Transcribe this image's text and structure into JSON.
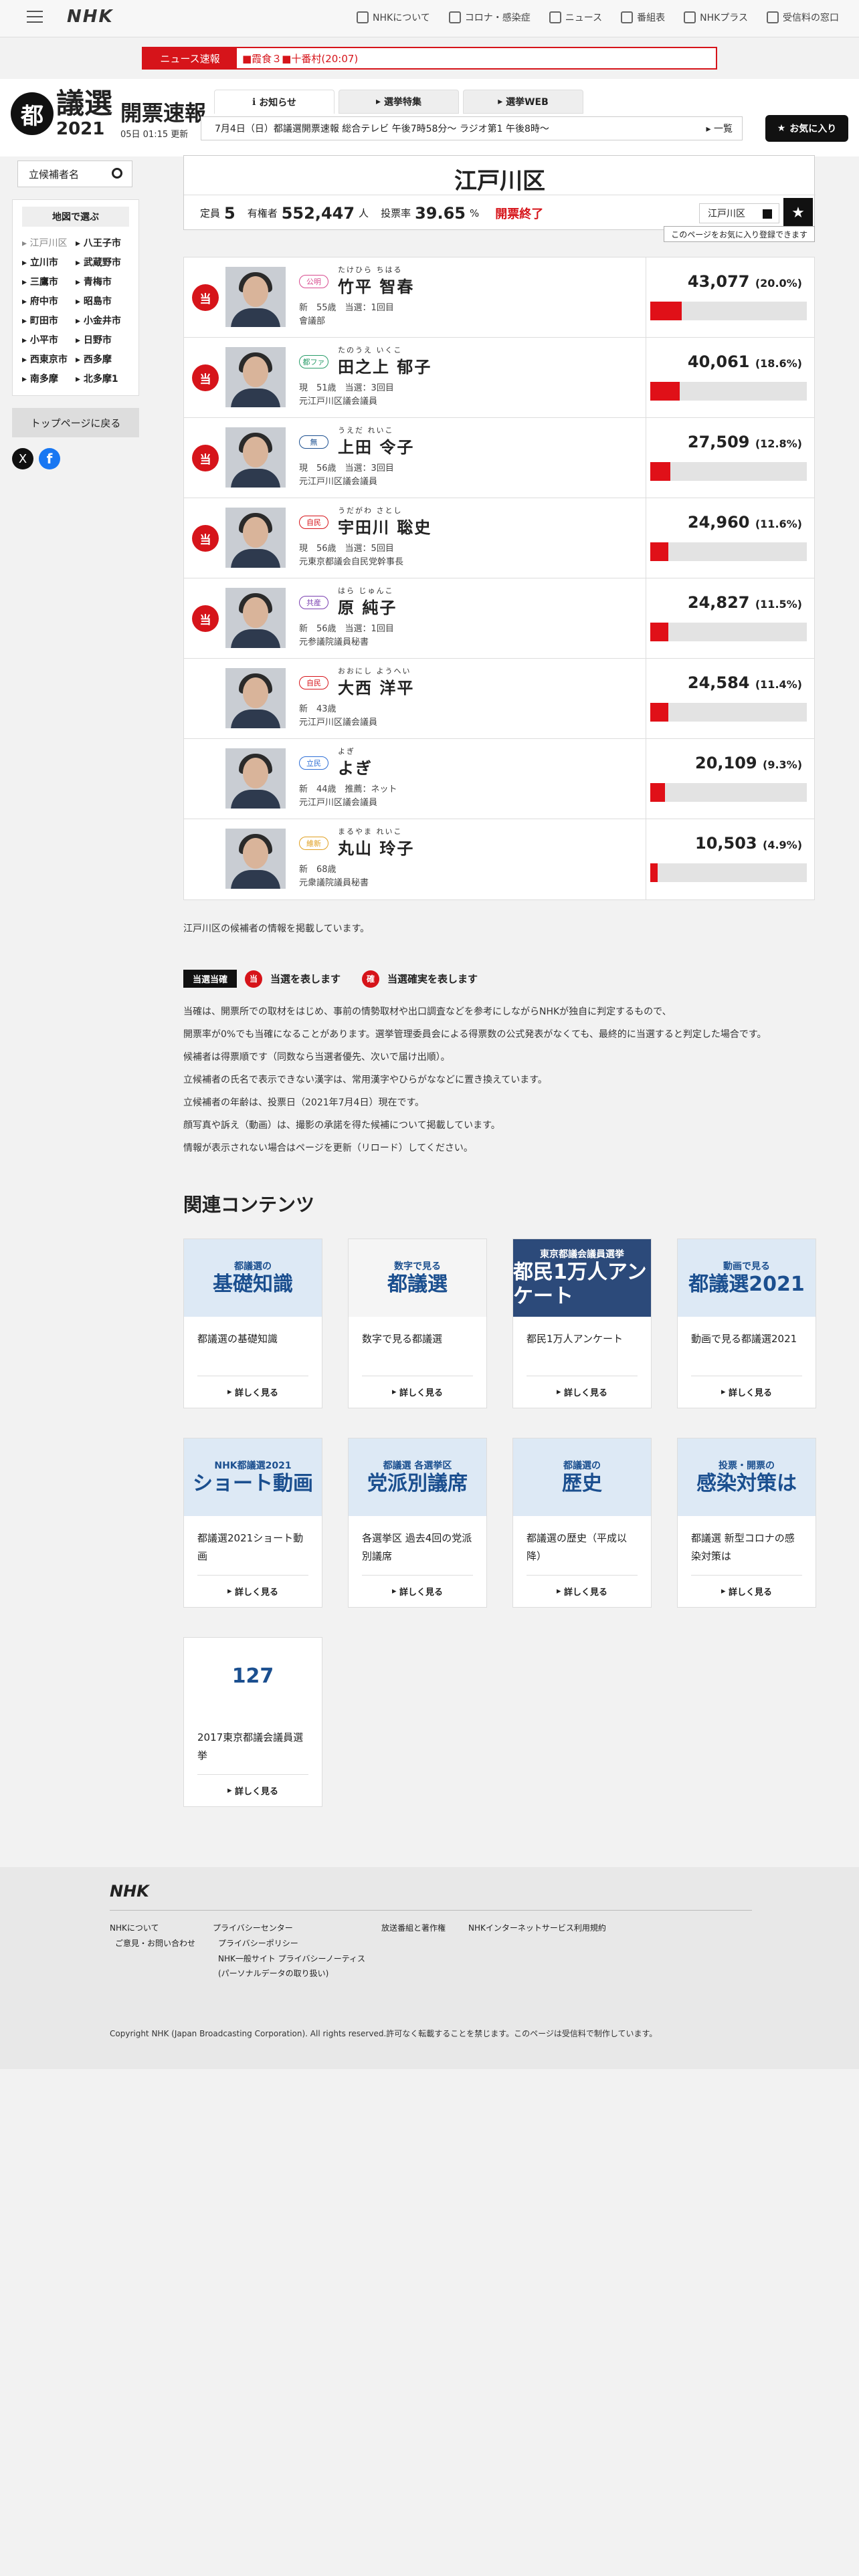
{
  "nav": {
    "logo": "NHK",
    "menu": [
      "NHKについて",
      "コロナ・感染症",
      "ニュース",
      "番組表",
      "NHKプラス",
      "受信料の窓口"
    ]
  },
  "breaking": {
    "label": "ニュース速報",
    "text": "■霞食３■十番村(20:07)"
  },
  "header": {
    "emblem": "都",
    "giin": "議選",
    "year": "2021",
    "title": "開票速報",
    "updated": "05日 01:15 更新",
    "tabs": [
      "お知らせ",
      "選挙特集",
      "選挙WEB"
    ],
    "ticker": "7月4日（日）都議選開票速報 総合テレビ 午後7時58分～ ラジオ第1 午後8時～",
    "ticker_more": "一覧",
    "fav_button": "お気に入り"
  },
  "sidebar": {
    "search_label": "立候補者名",
    "map_label": "地図で選ぶ",
    "districts": [
      "江戸川区",
      "八王子市",
      "立川市",
      "武蔵野市",
      "三鷹市",
      "青梅市",
      "府中市",
      "昭島市",
      "町田市",
      "小金井市",
      "小平市",
      "日野市",
      "西東京市",
      "西多摩",
      "南多摩",
      "北多摩1"
    ],
    "back_button": "トップページに戻る",
    "x_label": "X",
    "fb_label": "f"
  },
  "district": {
    "name": "江戸川区",
    "seats_label": "定員",
    "seats": "5",
    "voters_label": "有権者",
    "voters": "552,447",
    "voters_unit": "人",
    "turnout_label": "投票率",
    "turnout": "39.65",
    "turnout_unit": "%",
    "status": "開票終了",
    "select_value": "江戸川区",
    "register_note": "このページをお気に入り登録できます"
  },
  "candidates": [
    {
      "won": "当",
      "party": "公明",
      "party_color": "#d84b8f",
      "kana": "たけひら ちはる",
      "name": "竹平 智春",
      "meta": "新　55歳　当選：1回目",
      "career": "會議部",
      "votes": "43,077",
      "pct": "(20.0%)",
      "share": 0.2
    },
    {
      "won": "当",
      "party": "都ファ",
      "party_color": "#2a9d6a",
      "kana": "たのうえ いくこ",
      "name": "田之上 郁子",
      "meta": "現　51歳　当選：3回目",
      "career": "元江戸川区議会議員",
      "votes": "40,061",
      "pct": "(18.6%)",
      "share": 0.186
    },
    {
      "won": "当",
      "party": "無",
      "party_color": "#1b4f8f",
      "kana": "うえだ れいこ",
      "name": "上田 令子",
      "meta": "現　56歳　当選：3回目",
      "career": "元江戸川区議会議員",
      "votes": "27,509",
      "pct": "(12.8%)",
      "share": 0.128
    },
    {
      "won": "当",
      "party": "自民",
      "party_color": "#d6141a",
      "kana": "うだがわ さとし",
      "name": "宇田川 聡史",
      "meta": "現　56歳　当選：5回目",
      "career": "元東京都議会自民党幹事長",
      "votes": "24,960",
      "pct": "(11.6%)",
      "share": 0.116
    },
    {
      "won": "当",
      "party": "共産",
      "party_color": "#7a3fb0",
      "kana": "はら じゅんこ",
      "name": "原 純子",
      "meta": "新　56歳　当選：1回目",
      "career": "元参議院議員秘書",
      "votes": "24,827",
      "pct": "(11.5%)",
      "share": 0.115
    },
    {
      "won": "",
      "party": "自民",
      "party_color": "#d6141a",
      "kana": "おおにし ようへい",
      "name": "大西 洋平",
      "meta": "新　43歳",
      "career": "元江戸川区議会議員",
      "votes": "24,584",
      "pct": "(11.4%)",
      "share": 0.114
    },
    {
      "won": "",
      "party": "立民",
      "party_color": "#2f6fd6",
      "kana": "よぎ",
      "name": "よぎ",
      "meta": "新　44歳　推薦：ネット",
      "career": "元江戸川区議会議員",
      "votes": "20,109",
      "pct": "(9.3%)",
      "share": 0.093
    },
    {
      "won": "",
      "party": "維新",
      "party_color": "#e0a020",
      "kana": "まるやま れいこ",
      "name": "丸山 玲子",
      "meta": "新　68歳",
      "career": "元衆議院議員秘書",
      "votes": "10,503",
      "pct": "(4.9%)",
      "share": 0.049
    }
  ],
  "notes": {
    "intro": "江戸川区の候補者の情報を掲載しています。",
    "legend_tag": "当選当確",
    "legend_won_icon": "当",
    "legend_won": "当選を表します",
    "legend_sure_icon": "確",
    "legend_sure": "当選確実を表します",
    "lines": [
      "当確は、開票所での取材をはじめ、事前の情勢取材や出口調査などを参考にしながらNHKが独自に判定するもので、",
      "開票率が0%でも当確になることがあります。選挙管理委員会による得票数の公式発表がなくても、最終的に当選すると判定した場合です。",
      "候補者は得票順です（同数なら当選者優先、次いで届け出順）。",
      "立候補者の氏名で表示できない漢字は、常用漢字やひらがななどに置き換えています。",
      "立候補者の年齢は、投票日（2021年7月4日）現在です。",
      "顔写真や訴え（動画）は、撮影の承諾を得た候補について掲載しています。",
      "情報が表示されない場合はページを更新（リロード）してください。"
    ]
  },
  "related": {
    "title": "関連コンテンツ",
    "more_label": "詳しく見る",
    "cards": [
      {
        "thumb_top": "都議選の",
        "thumb_main": "基礎知識",
        "title": "都議選の基礎知識",
        "bg": "#dde9f5"
      },
      {
        "thumb_top": "数字で見る",
        "thumb_main": "都議選",
        "title": "数字で見る都議選",
        "bg": "#f5f5f5"
      },
      {
        "thumb_top": "東京都議会議員選挙",
        "thumb_main": "都民1万人アンケート",
        "title": "都民1万人アンケート",
        "bg": "#2c4a7a"
      },
      {
        "thumb_top": "動画で見る",
        "thumb_main": "都議選2021",
        "title": "動画で見る都議選2021",
        "bg": "#dde9f5"
      },
      {
        "thumb_top": "NHK都議選2021",
        "thumb_main": "ショート動画",
        "title": "都議選2021ショート動画",
        "bg": "#dde9f5"
      },
      {
        "thumb_top": "都議選 各選挙区",
        "thumb_main": "党派別議席",
        "title": "各選挙区 過去4回の党派別議席",
        "bg": "#dde9f5"
      },
      {
        "thumb_top": "都議選の",
        "thumb_main": "歴史",
        "title": "都議選の歴史（平成以降）",
        "bg": "#dde9f5"
      },
      {
        "thumb_top": "投票・開票の",
        "thumb_main": "感染対策は",
        "title": "都議選 新型コロナの感染対策は",
        "bg": "#dde9f5"
      },
      {
        "thumb_top": "",
        "thumb_main": "127",
        "title": "2017東京都議会議員選挙",
        "bg": "#ffffff"
      }
    ]
  },
  "footer": {
    "logo": "NHK",
    "col1": [
      "NHKについて",
      "ご意見・お問い合わせ"
    ],
    "col2": [
      "プライバシーセンター",
      "プライバシーポリシー",
      "NHK一般サイト プライバシーノーティス",
      "(パーソナルデータの取り扱い)"
    ],
    "col3": [
      "放送番組と著作権"
    ],
    "col4": [
      "NHKインターネットサービス利用規約"
    ],
    "copyright": "Copyright NHK (Japan Broadcasting Corporation). All rights reserved.許可なく転載することを禁じます。このページは受信料で制作しています。"
  },
  "colors": {
    "accent": "#d6141a",
    "bar_bg": "#e3e3e3"
  }
}
